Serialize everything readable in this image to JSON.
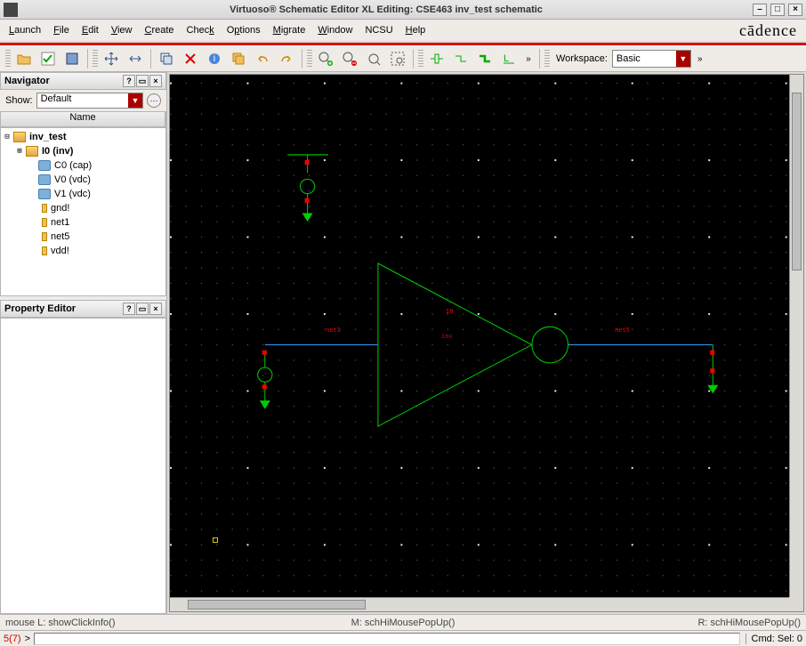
{
  "title": "Virtuoso® Schematic Editor XL Editing: CSE463 inv_test schematic",
  "menu": [
    "Launch",
    "File",
    "Edit",
    "View",
    "Create",
    "Check",
    "Options",
    "Migrate",
    "Window",
    "NCSU",
    "Help"
  ],
  "brand": "cādence",
  "workspace": {
    "label": "Workspace:",
    "value": "Basic"
  },
  "navigator": {
    "title": "Navigator",
    "show_label": "Show:",
    "show_value": "Default",
    "col": "Name",
    "items": [
      {
        "level": 0,
        "exp": "⊟",
        "icon": "fold",
        "label": "inv_test",
        "bold": true
      },
      {
        "level": 1,
        "exp": "⊞",
        "icon": "fold",
        "label": "I0 (inv)",
        "bold": true
      },
      {
        "level": 1,
        "exp": "",
        "icon": "comp",
        "label": "C0 (cap)"
      },
      {
        "level": 1,
        "exp": "",
        "icon": "comp",
        "label": "V0 (vdc)"
      },
      {
        "level": 1,
        "exp": "",
        "icon": "comp",
        "label": "V1 (vdc)"
      },
      {
        "level": 1,
        "exp": "",
        "icon": "net",
        "label": "gnd!"
      },
      {
        "level": 1,
        "exp": "",
        "icon": "net",
        "label": "net1"
      },
      {
        "level": 1,
        "exp": "",
        "icon": "net",
        "label": "net5"
      },
      {
        "level": 1,
        "exp": "",
        "icon": "net",
        "label": "vdd!"
      }
    ]
  },
  "property_editor": {
    "title": "Property Editor"
  },
  "schematic": {
    "instance_label": "I0",
    "cell_label": "inv",
    "net_in": "net1",
    "net_out": "net5"
  },
  "status": {
    "left": "mouse L: showClickInfo()",
    "mid": "M: schHiMousePopUp()",
    "right": "R: schHiMousePopUp()"
  },
  "cmd": {
    "left": "5(7)",
    "prompt": ">",
    "sel": "Cmd: Sel: 0"
  }
}
